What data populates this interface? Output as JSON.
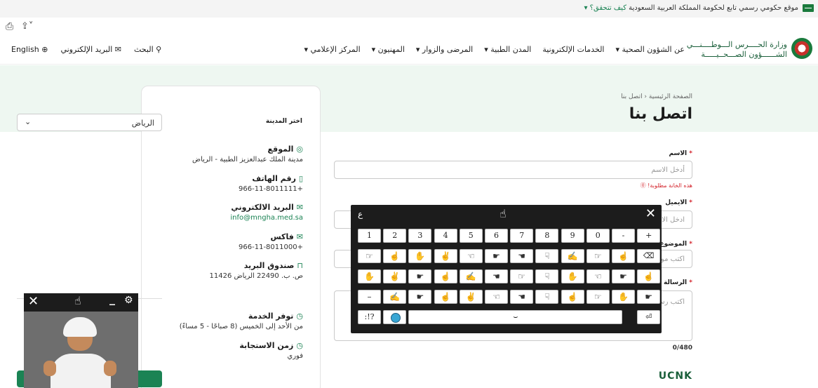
{
  "govbar": {
    "text": "موقع حكومي رسمي تابع لحكومة المملكة العربية السعودية",
    "verify": "كيف تتحقق؟ ▾"
  },
  "header": {
    "logo_line1": "وزارة الحــــرس الـــوطــــنـــي",
    "logo_line2": "الشــــــؤون الصـــحــيـــــة",
    "nav": [
      "عن الشؤون الصحية ▾",
      "الخدمات الإلكترونية",
      "المدن الطبية ▾",
      "المرضى والزوار ▾",
      "المهنيون ▾",
      "المركز الإعلامي ▾"
    ],
    "search": "البحث",
    "email": "البريد الإلكتروني",
    "english": "English"
  },
  "hero": {
    "breadcrumb": "الصفحة الرئيسية ‹ اتصل بنا",
    "title": "اتصل بنا"
  },
  "card": {
    "city_label": "اختر المدينة",
    "city_value": "الرياض",
    "location_title": "الموقع",
    "location_value": "مدينة الملك عبدالعزيز الطبية - الرياض",
    "phone_title": "رقم الهاتف",
    "phone_value": "+966-11-8011111",
    "email_title": "البريد الالكتروني",
    "email_value": "info@mngha.med.sa",
    "fax_title": "فاكس",
    "fax_value": "+966-11-8011000",
    "pobox_title": "صندوق البريد",
    "pobox_value": "ص. ب. 22490 الرياض 11426",
    "hours_title": "توفر الخدمة",
    "hours_value": "من الأحد إلى الخميس (8 صباحًا - 5 مساءً)",
    "response_title": "زمن الاستجابة",
    "response_value": "فوري",
    "location_button": "الموقع"
  },
  "form": {
    "name_label": "الاسم",
    "name_placeholder": "أدخل الاسم",
    "name_error": "هذه الخانة مطلوبة!",
    "email_label": "الايميل",
    "email_placeholder": "ادخل الا",
    "subject_label": "الموضوع",
    "subject_placeholder": "اكتب مو",
    "message_label": "الرسالة",
    "message_placeholder": "اكتب رسـ",
    "counter": "0/480",
    "captcha": "UCNK",
    "required_mark": "*"
  },
  "keyboard": {
    "lang": "ع",
    "row1": [
      "1",
      "2",
      "3",
      "4",
      "5",
      "6",
      "7",
      "8",
      "9",
      "0",
      "-",
      "+"
    ],
    "row2_signs": [
      "☞",
      "☝",
      "✋",
      "✌",
      "☜",
      "☛",
      "☚",
      "☟",
      "✍",
      "☞",
      "☝"
    ],
    "backspace": "⌫",
    "row3_signs": [
      "✋",
      "✌",
      "☛",
      "☝",
      "✍",
      "☚",
      "☞",
      "☟",
      "✋",
      "☜",
      "☛",
      "☝"
    ],
    "row4_signs": [
      "–",
      "✍",
      "☛",
      "☝",
      "✌",
      "☜",
      "☚",
      "☟",
      "☝",
      "☞",
      "✋",
      "☛"
    ],
    "sym": ":!?",
    "space": "⌣",
    "enter": "⏎"
  }
}
